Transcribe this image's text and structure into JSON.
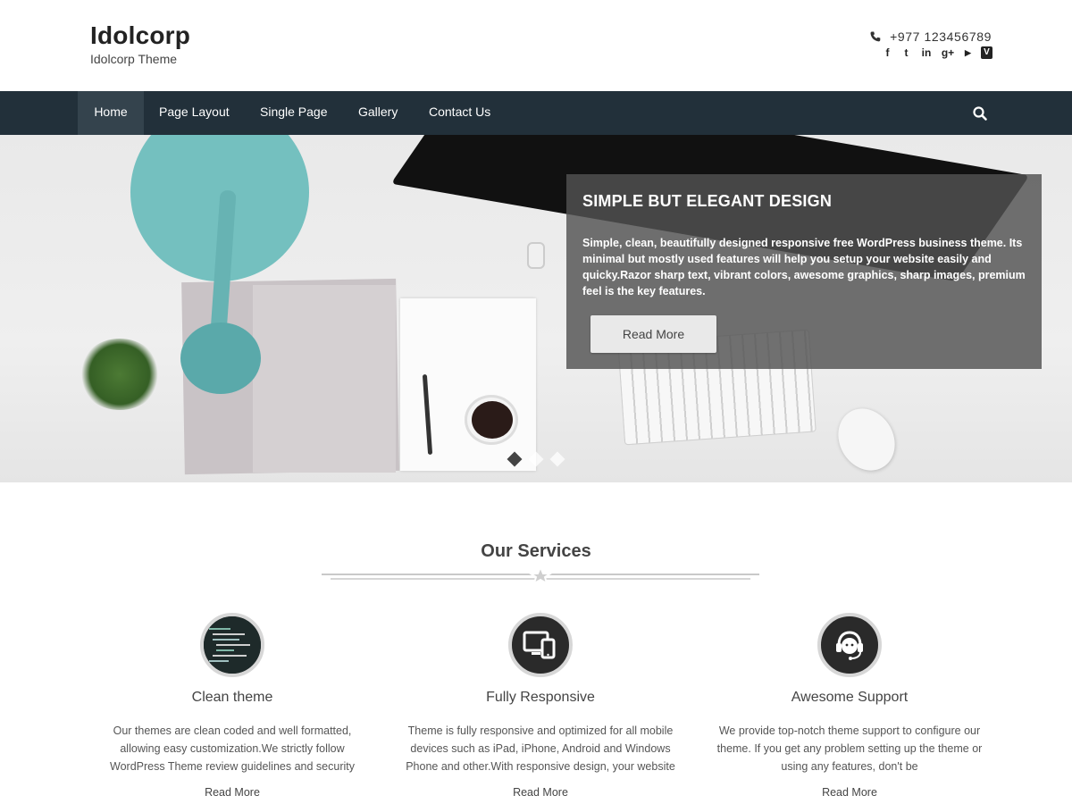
{
  "header": {
    "site_title": "Idolcorp",
    "site_description": "Idolcorp Theme",
    "phone": "+977 123456789",
    "phone_icon": "phone-icon",
    "socials": [
      {
        "name": "facebook-icon",
        "glyph": "f"
      },
      {
        "name": "twitter-icon",
        "glyph": "t"
      },
      {
        "name": "linkedin-icon",
        "glyph": "in"
      },
      {
        "name": "google-plus-icon",
        "glyph": "g+"
      },
      {
        "name": "youtube-icon",
        "glyph": "▶"
      },
      {
        "name": "vimeo-icon",
        "glyph": "V"
      }
    ]
  },
  "nav": {
    "items": [
      {
        "label": "Home",
        "active": true
      },
      {
        "label": "Page Layout",
        "active": false
      },
      {
        "label": "Single Page",
        "active": false
      },
      {
        "label": "Gallery",
        "active": false
      },
      {
        "label": "Contact Us",
        "active": false
      }
    ],
    "search_icon": "search-icon"
  },
  "slider": {
    "title": "SIMPLE BUT ELEGANT DESIGN",
    "text": "Simple, clean, beautifully designed responsive free WordPress business theme. Its minimal but mostly used features will help you setup your website easily and quicky.Razor sharp text, vibrant colors, awesome graphics, sharp images, premium feel is the key features.",
    "button": "Read More",
    "slide_count": 3,
    "active_slide": 1
  },
  "services": {
    "title": "Our Services",
    "items": [
      {
        "title": "Clean theme",
        "icon": "code-screen-icon",
        "text": "Our themes are clean coded and well formatted, allowing easy customization.We strictly follow WordPress Theme review guidelines and security",
        "link": "Read More"
      },
      {
        "title": "Fully Responsive",
        "icon": "devices-icon",
        "text": "Theme is fully responsive and optimized for all mobile devices such as iPad, iPhone, Android and Windows Phone and other.With responsive design, your website",
        "link": "Read More"
      },
      {
        "title": "Awesome Support",
        "icon": "headset-support-icon",
        "text": "We provide top-notch theme support to configure our theme. If you get any problem setting up the theme or using any features, don't be",
        "link": "Read More"
      }
    ]
  },
  "colors": {
    "nav_bg": "#22303a",
    "nav_active": "#34434d",
    "caption_bg": "#525252"
  }
}
